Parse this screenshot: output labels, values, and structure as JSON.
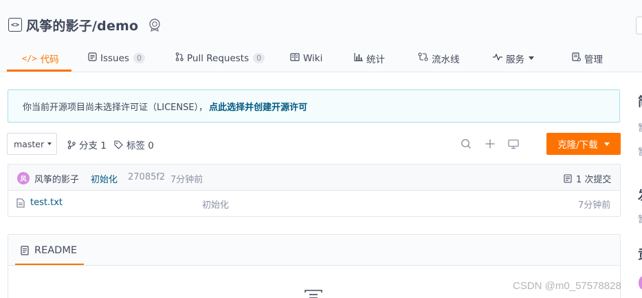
{
  "repo": {
    "icon": "code-repo-icon",
    "name": "风筝的影子/demo",
    "badge_icon": "award-badge-icon"
  },
  "tabs": [
    {
      "label": "代码",
      "icon": "code-icon",
      "active": true
    },
    {
      "label": "Issues",
      "icon": "issues-icon",
      "count": "0"
    },
    {
      "label": "Pull Requests",
      "icon": "pull-request-icon",
      "count": "0"
    },
    {
      "label": "Wiki",
      "icon": "wiki-book-icon"
    },
    {
      "label": "统计",
      "icon": "stats-chart-icon"
    },
    {
      "label": "流水线",
      "icon": "pipeline-icon"
    },
    {
      "label": "服务",
      "icon": "service-pulse-icon",
      "has_dropdown": true
    },
    {
      "label": "管理",
      "icon": "manage-doc-icon"
    }
  ],
  "license_notice": {
    "text": "你当前开源项目尚未选择许可证（LICENSE），",
    "link": "点此选择并创建开源许可"
  },
  "toolbar": {
    "branch": "master",
    "branches_label": "分支 1",
    "tags_label": "标签 0",
    "clone_label": "克隆/下载"
  },
  "commit": {
    "avatar_text": "风",
    "author": "风筝的影子",
    "message": "初始化",
    "hash": "27085f2",
    "time": "7分钟前",
    "commits_label": "1 次提交"
  },
  "files": [
    {
      "name": "test.txt",
      "message": "初始化",
      "time": "7分钟前"
    }
  ],
  "readme": {
    "title": "README"
  },
  "sidebar_partial": {
    "heading_1": "简",
    "line_1": "暂",
    "line_2": "暂",
    "heading_2": "发",
    "line_3": "暂",
    "heading_3": "贡"
  },
  "watermark": "CSDN @m0_57578828",
  "colors": {
    "accent": "#fe7300",
    "text": "#40485b",
    "link": "#005980",
    "notice_bg": "#f4fcfd",
    "notice_border": "#a6dfe8"
  }
}
